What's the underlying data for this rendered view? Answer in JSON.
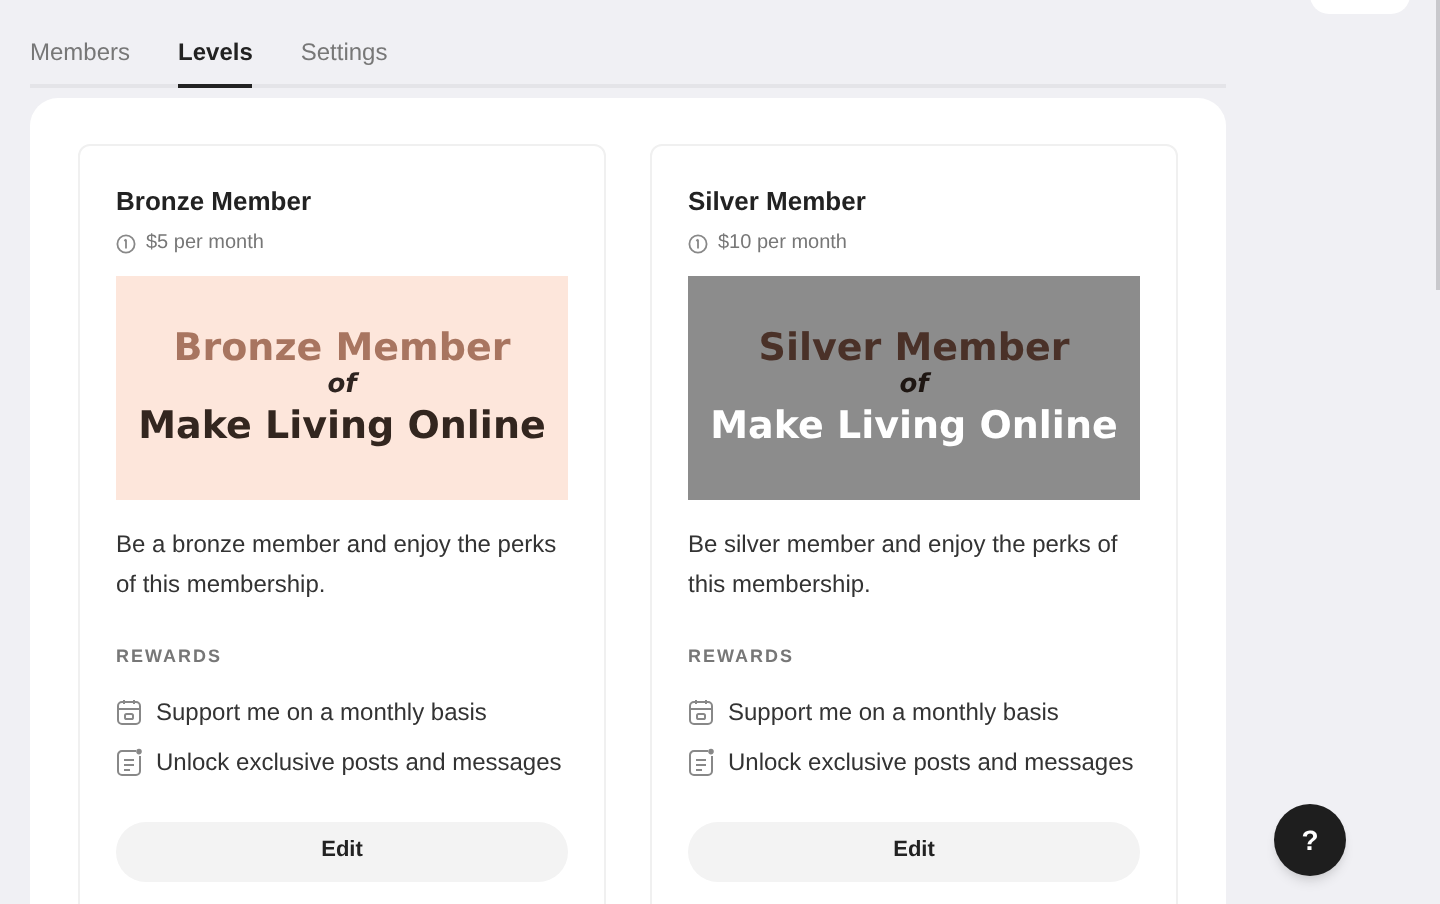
{
  "tabs": [
    {
      "label": "Members",
      "selected": false
    },
    {
      "label": "Levels",
      "selected": true
    },
    {
      "label": "Settings",
      "selected": false
    }
  ],
  "levels": [
    {
      "name": "Bronze Member",
      "price": "$5 per month",
      "banner": {
        "kind": "bronze",
        "title": "Bronze Member",
        "joiner": "of",
        "subtitle": "Make Living Online"
      },
      "description": "Be a bronze member and enjoy the perks of this membership.",
      "rewards_label": "REWARDS",
      "rewards": [
        {
          "kind": "calendar",
          "text": "Support me on a monthly basis"
        },
        {
          "kind": "post",
          "text": "Unlock exclusive posts and messages"
        }
      ],
      "button": "Edit"
    },
    {
      "name": "Silver Member",
      "price": "$10 per month",
      "banner": {
        "kind": "silver",
        "title": "Silver Member",
        "joiner": "of",
        "subtitle": "Make Living Online"
      },
      "description": "Be silver member and enjoy the perks of this membership.",
      "rewards_label": "REWARDS",
      "rewards": [
        {
          "kind": "calendar",
          "text": "Support me on a monthly basis"
        },
        {
          "kind": "post",
          "text": "Unlock exclusive posts and messages"
        }
      ],
      "button": "Edit"
    }
  ],
  "help_button": "?"
}
